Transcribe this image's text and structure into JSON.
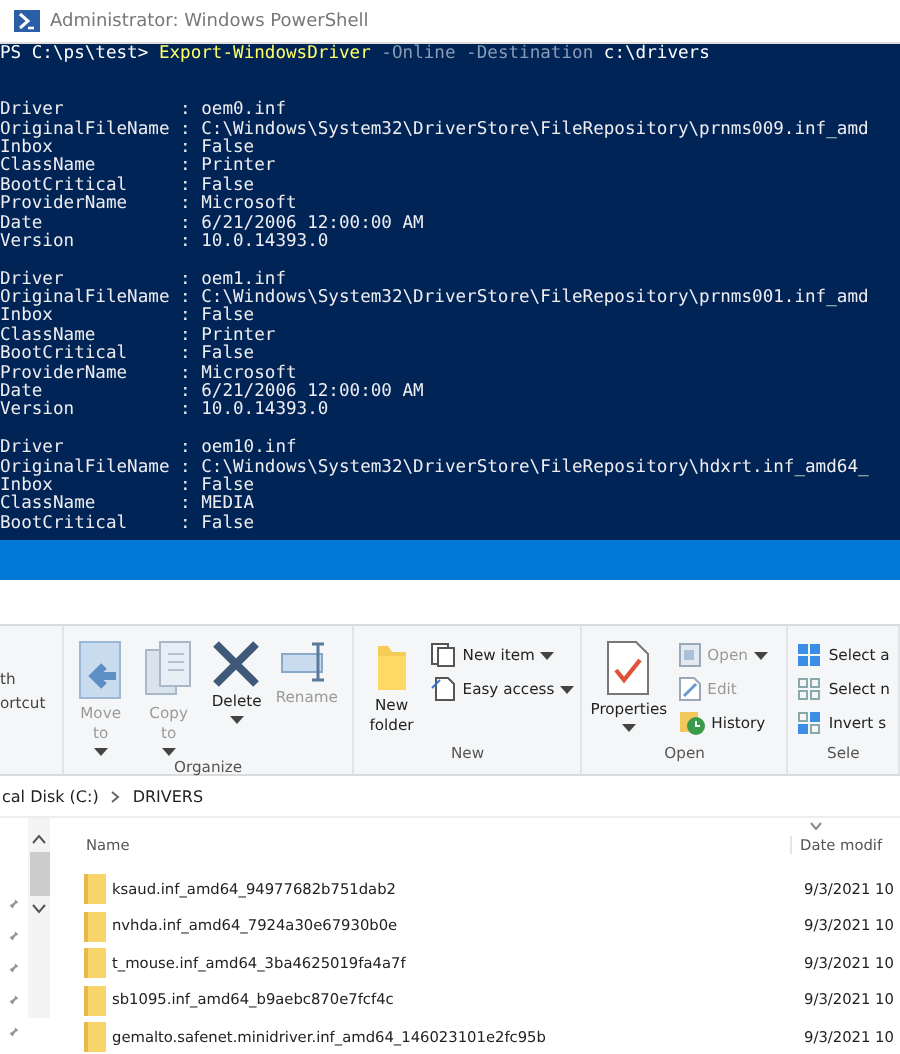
{
  "powershell": {
    "title": "Administrator: Windows PowerShell",
    "command": {
      "prompt": "PS C:\\ps\\test>",
      "cmdlet": "Export-WindowsDriver",
      "parameters": "-Online -Destination",
      "argument": "c:\\drivers"
    },
    "results": [
      {
        "lines": [
          "Driver           : oem0.inf",
          "OriginalFileName : C:\\Windows\\System32\\DriverStore\\FileRepository\\prnms009.inf_amd",
          "Inbox            : False",
          "ClassName        : Printer",
          "BootCritical     : False",
          "ProviderName     : Microsoft",
          "Date             : 6/21/2006 12:00:00 AM",
          "Version          : 10.0.14393.0"
        ]
      },
      {
        "lines": [
          "Driver           : oem1.inf",
          "OriginalFileName : C:\\Windows\\System32\\DriverStore\\FileRepository\\prnms001.inf_amd",
          "Inbox            : False",
          "ClassName        : Printer",
          "BootCritical     : False",
          "ProviderName     : Microsoft",
          "Date             : 6/21/2006 12:00:00 AM",
          "Version          : 10.0.14393.0"
        ]
      },
      {
        "lines": [
          "Driver           : oem10.inf",
          "OriginalFileName : C:\\Windows\\System32\\DriverStore\\FileRepository\\hdxrt.inf_amd64_",
          "Inbox            : False",
          "ClassName        : MEDIA",
          "BootCritical     : False"
        ]
      }
    ]
  },
  "explorer": {
    "ribbon": {
      "cut_labels": [
        "th",
        "ortcut"
      ],
      "groups": [
        {
          "label": "Organize",
          "items": [
            {
              "kind": "large",
              "label": "Move to",
              "dropdown": true,
              "disabled": true
            },
            {
              "kind": "large",
              "label": "Copy to",
              "dropdown": true,
              "disabled": true
            },
            {
              "kind": "large",
              "label": "Delete",
              "dropdown": true,
              "disabled": false
            },
            {
              "kind": "large",
              "label": "Rename",
              "dropdown": false,
              "disabled": true
            }
          ]
        },
        {
          "label": "New",
          "items": [
            {
              "kind": "large",
              "label": "New folder",
              "dropdown": false,
              "disabled": false
            },
            {
              "kind": "small",
              "label": "New item",
              "dropdown": true,
              "disabled": false
            },
            {
              "kind": "small",
              "label": "Easy access",
              "dropdown": true,
              "disabled": false
            }
          ]
        },
        {
          "label": "Open",
          "items": [
            {
              "kind": "large",
              "label": "Properties",
              "dropdown": true,
              "disabled": false
            },
            {
              "kind": "small",
              "label": "Open",
              "dropdown": true,
              "disabled": true
            },
            {
              "kind": "small",
              "label": "Edit",
              "dropdown": false,
              "disabled": true
            },
            {
              "kind": "small",
              "label": "History",
              "dropdown": false,
              "disabled": false
            }
          ]
        },
        {
          "label": "Sele",
          "items": [
            {
              "kind": "small",
              "label": "Select a",
              "dropdown": false,
              "disabled": false
            },
            {
              "kind": "small",
              "label": "Select n",
              "dropdown": false,
              "disabled": false
            },
            {
              "kind": "small",
              "label": "Invert s",
              "dropdown": false,
              "disabled": false
            }
          ]
        }
      ]
    },
    "breadcrumb": [
      "cal Disk (C:)",
      "DRIVERS"
    ],
    "columns": [
      "Name",
      "Date modif"
    ],
    "rows": [
      {
        "name": "ksaud.inf_amd64_94977682b751dab2",
        "date": "9/3/2021 10"
      },
      {
        "name": "nvhda.inf_amd64_7924a30e67930b0e",
        "date": "9/3/2021 10"
      },
      {
        "name": "t_mouse.inf_amd64_3ba4625019fa4a7f",
        "date": "9/3/2021 10"
      },
      {
        "name": "sb1095.inf_amd64_b9aebc870e7fcf4c",
        "date": "9/3/2021 10"
      },
      {
        "name": "gemalto.safenet.minidriver.inf_amd64_146023101e2fc95b",
        "date": "9/3/2021 10"
      }
    ]
  }
}
